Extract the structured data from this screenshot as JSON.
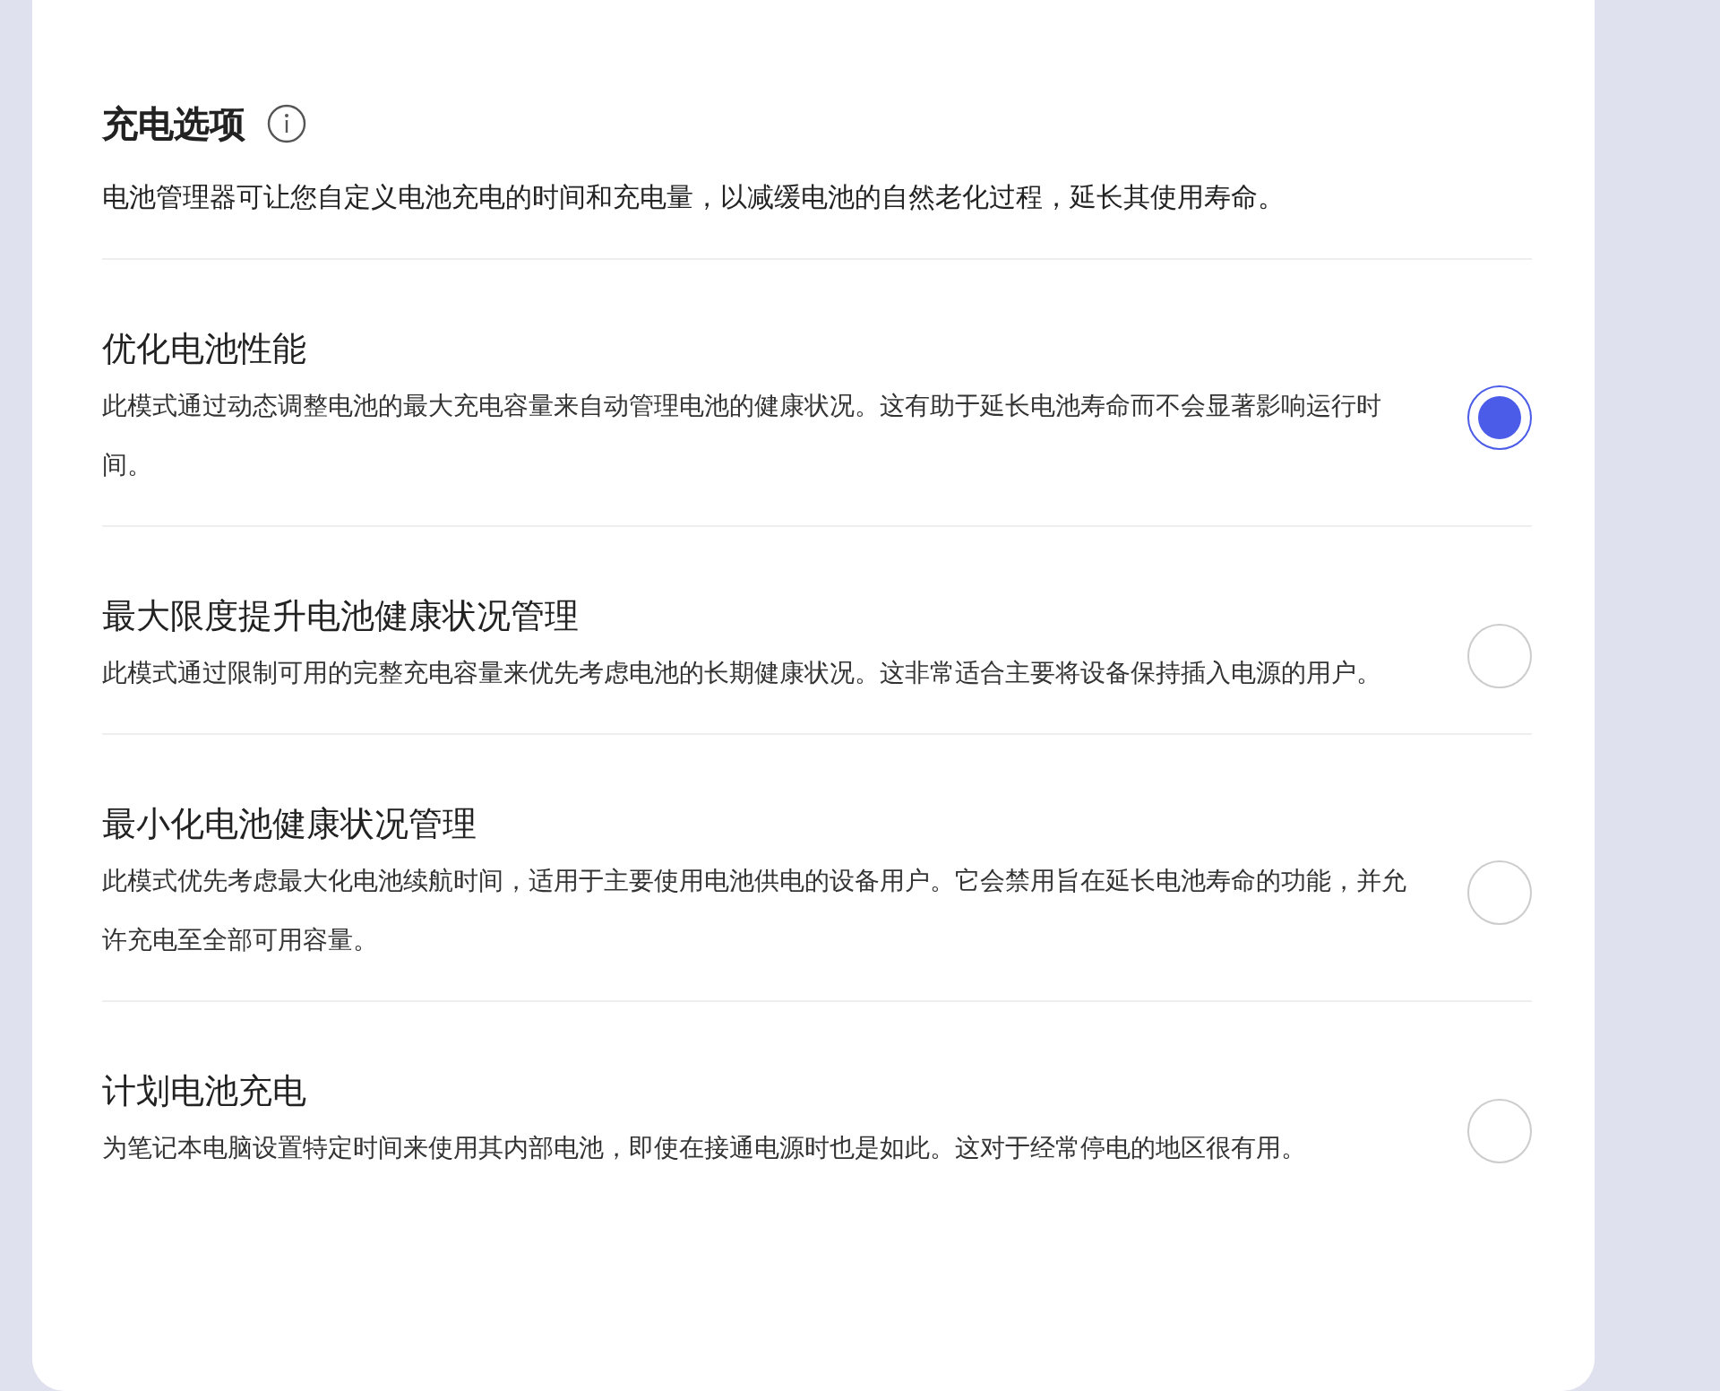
{
  "section": {
    "title": "充电选项",
    "description": "电池管理器可让您自定义电池充电的时间和充电量，以减缓电池的自然老化过程，延长其使用寿命。"
  },
  "options": [
    {
      "title": "优化电池性能",
      "description": "此模式通过动态调整电池的最大充电容量来自动管理电池的健康状况。这有助于延长电池寿命而不会显著影响运行时间。",
      "selected": true
    },
    {
      "title": "最大限度提升电池健康状况管理",
      "description": "此模式通过限制可用的完整充电容量来优先考虑电池的长期健康状况。这非常适合主要将设备保持插入电源的用户。",
      "selected": false
    },
    {
      "title": "最小化电池健康状况管理",
      "description": "此模式优先考虑最大化电池续航时间，适用于主要使用电池供电的设备用户。它会禁用旨在延长电池寿命的功能，并允许充电至全部可用容量。",
      "selected": false
    },
    {
      "title": "计划电池充电",
      "description": "为笔记本电脑设置特定时间来使用其内部电池，即使在接通电源时也是如此。这对于经常停电的地区很有用。",
      "selected": false
    }
  ]
}
